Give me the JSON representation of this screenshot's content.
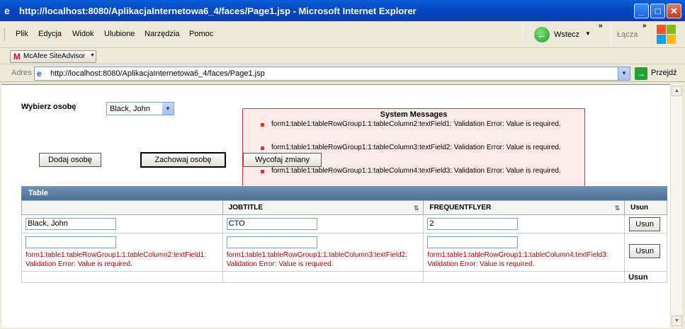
{
  "window": {
    "title": "http://localhost:8080/AplikacjaInternetowa6_4/faces/Page1.jsp - Microsoft Internet Explorer",
    "btn_min": "_",
    "btn_max": "□",
    "btn_close": "✕"
  },
  "menu": {
    "items": [
      "Plik",
      "Edycja",
      "Widok",
      "Ulubione",
      "Narzędzia",
      "Pomoc"
    ],
    "back_label": "Wstecz",
    "links_label": "Łącza"
  },
  "mcafee": {
    "label": "McAfee SiteAdvisor",
    "m": "M"
  },
  "address": {
    "label": "Adres",
    "url": "http://localhost:8080/AplikacjaInternetowa6_4/faces/Page1.jsp",
    "go_label": "Przejdź"
  },
  "page": {
    "pick_label": "Wybierz osobę",
    "selected_person": "Black, John",
    "btn_add": "Dodaj osobę",
    "btn_save": "Zachowaj osobę",
    "btn_revert": "Wycofaj zmiany",
    "messages": {
      "title": "System Messages",
      "items": [
        "form1:table1:tableRowGroup1:1:tableColumn2:textField1: Validation Error: Value is required.",
        "form1:table1:tableRowGroup1:1:tableColumn3:textField2: Validation Error: Value is required.",
        "form1:table1:tableRowGroup1:1:tableColumn4:textField3: Validation Error: Value is required."
      ]
    },
    "table": {
      "title": "Table",
      "headers": [
        "",
        "JOBTITLE",
        "FREQUENTFLYER",
        "Usun"
      ],
      "row1": {
        "name": "Black, John",
        "job": "CTO",
        "ff": "2",
        "btn": "Usun"
      },
      "row2": {
        "err1a": "form1:table1:tableRowGroup1:1:tableColumn2:textField1:",
        "err1b": "Validation Error: Value is required.",
        "err2a": "form1:table1:tableRowGroup1:1:tableColumn3:textField2:",
        "err2b": "Validation Error: Value is required.",
        "err3a": "form1:table1:tableRowGroup1:1:tableColumn4:textField3:",
        "err3b": "Validation Error: Value is required.",
        "btn": "Usun"
      },
      "footer": "Usun"
    }
  }
}
